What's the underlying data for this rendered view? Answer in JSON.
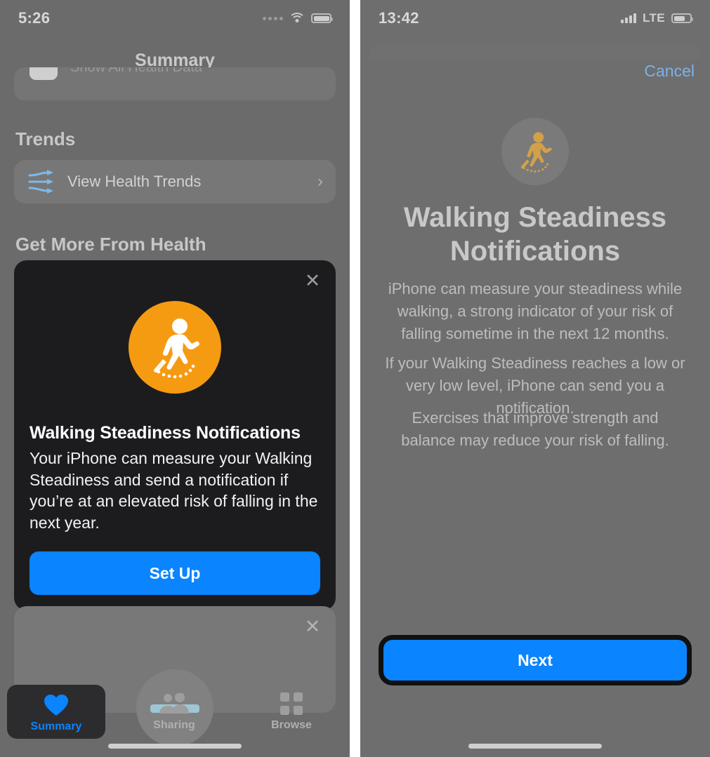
{
  "left_screen": {
    "status_bar": {
      "time": "5:26",
      "signal_icon": "cellular-dots-icon",
      "wifi_icon": "wifi-icon",
      "battery_icon": "battery-icon"
    },
    "nav_title": "Summary",
    "cut_row_label": "Show All Health Data",
    "sections": [
      {
        "heading": "Trends"
      },
      {
        "heading": "Get More From Health"
      }
    ],
    "trends_row": {
      "icon": "health-trends-arrows-icon",
      "label": "View Health Trends",
      "chevron": "›"
    },
    "promo_card": {
      "close_icon": "close-x-icon",
      "icon": "walking-person-icon",
      "icon_bg_color": "#f59b12",
      "title": "Walking Steadiness Notifications",
      "body": "Your iPhone can measure your Walking Steadiness and send a notification if you’re at an elevated risk of falling in the next year.",
      "button_label": "Set Up",
      "button_color": "#0a84ff"
    },
    "promo_card_2": {
      "close_icon": "close-x-icon"
    },
    "tab_bar": {
      "tabs": [
        {
          "label": "Summary",
          "icon": "heart-icon",
          "selected": true
        },
        {
          "label": "Sharing",
          "icon": "people-icon",
          "selected": false
        },
        {
          "label": "Browse",
          "icon": "grid-icon",
          "selected": false
        }
      ],
      "accent_color": "#0a84ff"
    }
  },
  "right_screen": {
    "status_bar": {
      "time": "13:42",
      "signal_icon": "cellular-bars-icon",
      "network_label": "LTE",
      "battery_icon": "battery-icon"
    },
    "cancel_label": "Cancel",
    "hero_icon": "walking-person-icon",
    "title": "Walking Steadiness Notifications",
    "paragraphs": [
      "iPhone can measure your steadiness while walking, a strong indicator of your risk of falling sometime in the next 12 months.",
      "If your Walking Steadiness reaches a low or very low level, iPhone can send you a notification.",
      "Exercises that improve strength and balance may reduce your risk of falling."
    ],
    "primary_button": {
      "label": "Next",
      "color": "#0a84ff",
      "highlighted": true
    }
  }
}
